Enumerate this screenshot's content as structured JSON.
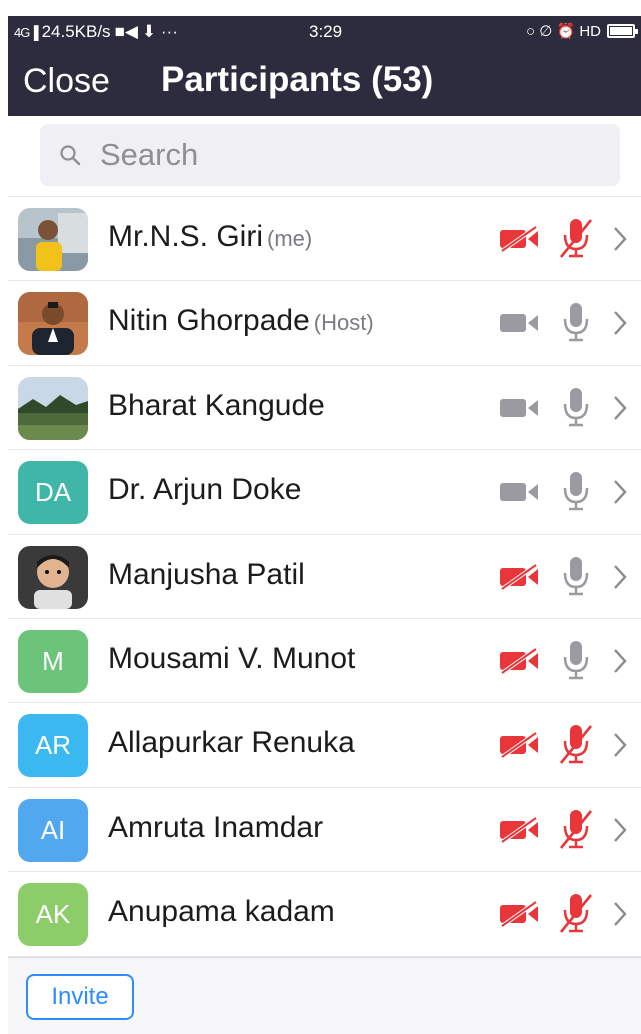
{
  "status_bar": {
    "network_speed": "24.5KB/s",
    "extra": "⬇ ···",
    "time": "3:29",
    "right_icons": "○ ∅ ⏰ HD",
    "battery_level": 1.0
  },
  "header": {
    "close_label": "Close",
    "title": "Participants (53)"
  },
  "search": {
    "placeholder": "Search"
  },
  "colors": {
    "header_bg": "#2c2c3e",
    "muted_red": "#e8363a",
    "active_gray": "#9a9aa0",
    "invite_blue": "#2d8cff"
  },
  "participants": [
    {
      "name": "Mr.N.S. Giri",
      "role": "(me)",
      "avatar_type": "photo-man-yellow",
      "video_muted": true,
      "audio_muted": true
    },
    {
      "name": "Nitin Ghorpade",
      "role": "(Host)",
      "avatar_type": "photo-man-suit",
      "video_muted": false,
      "audio_muted": false
    },
    {
      "name": "Bharat Kangude",
      "role": "",
      "avatar_type": "photo-landscape",
      "video_muted": false,
      "audio_muted": false
    },
    {
      "name": "Dr. Arjun Doke",
      "role": "",
      "initials": "DA",
      "avatar_color": "#3fb6a8",
      "video_muted": false,
      "audio_muted": false
    },
    {
      "name": "Manjusha Patil",
      "role": "",
      "avatar_type": "photo-child",
      "video_muted": true,
      "audio_muted": false
    },
    {
      "name": "Mousami  V. Munot",
      "role": "",
      "initials": "M",
      "avatar_color": "#6cc47a",
      "video_muted": true,
      "audio_muted": false
    },
    {
      "name": "Allapurkar Renuka",
      "role": "",
      "initials": "AR",
      "avatar_color": "#3cb8f0",
      "video_muted": true,
      "audio_muted": true
    },
    {
      "name": "Amruta Inamdar",
      "role": "",
      "initials": "AI",
      "avatar_color": "#52a8ee",
      "video_muted": true,
      "audio_muted": true
    },
    {
      "name": "Anupama kadam",
      "role": "",
      "initials": "AK",
      "avatar_color": "#8ccd6a",
      "video_muted": true,
      "audio_muted": true
    }
  ],
  "footer": {
    "invite_label": "Invite"
  }
}
